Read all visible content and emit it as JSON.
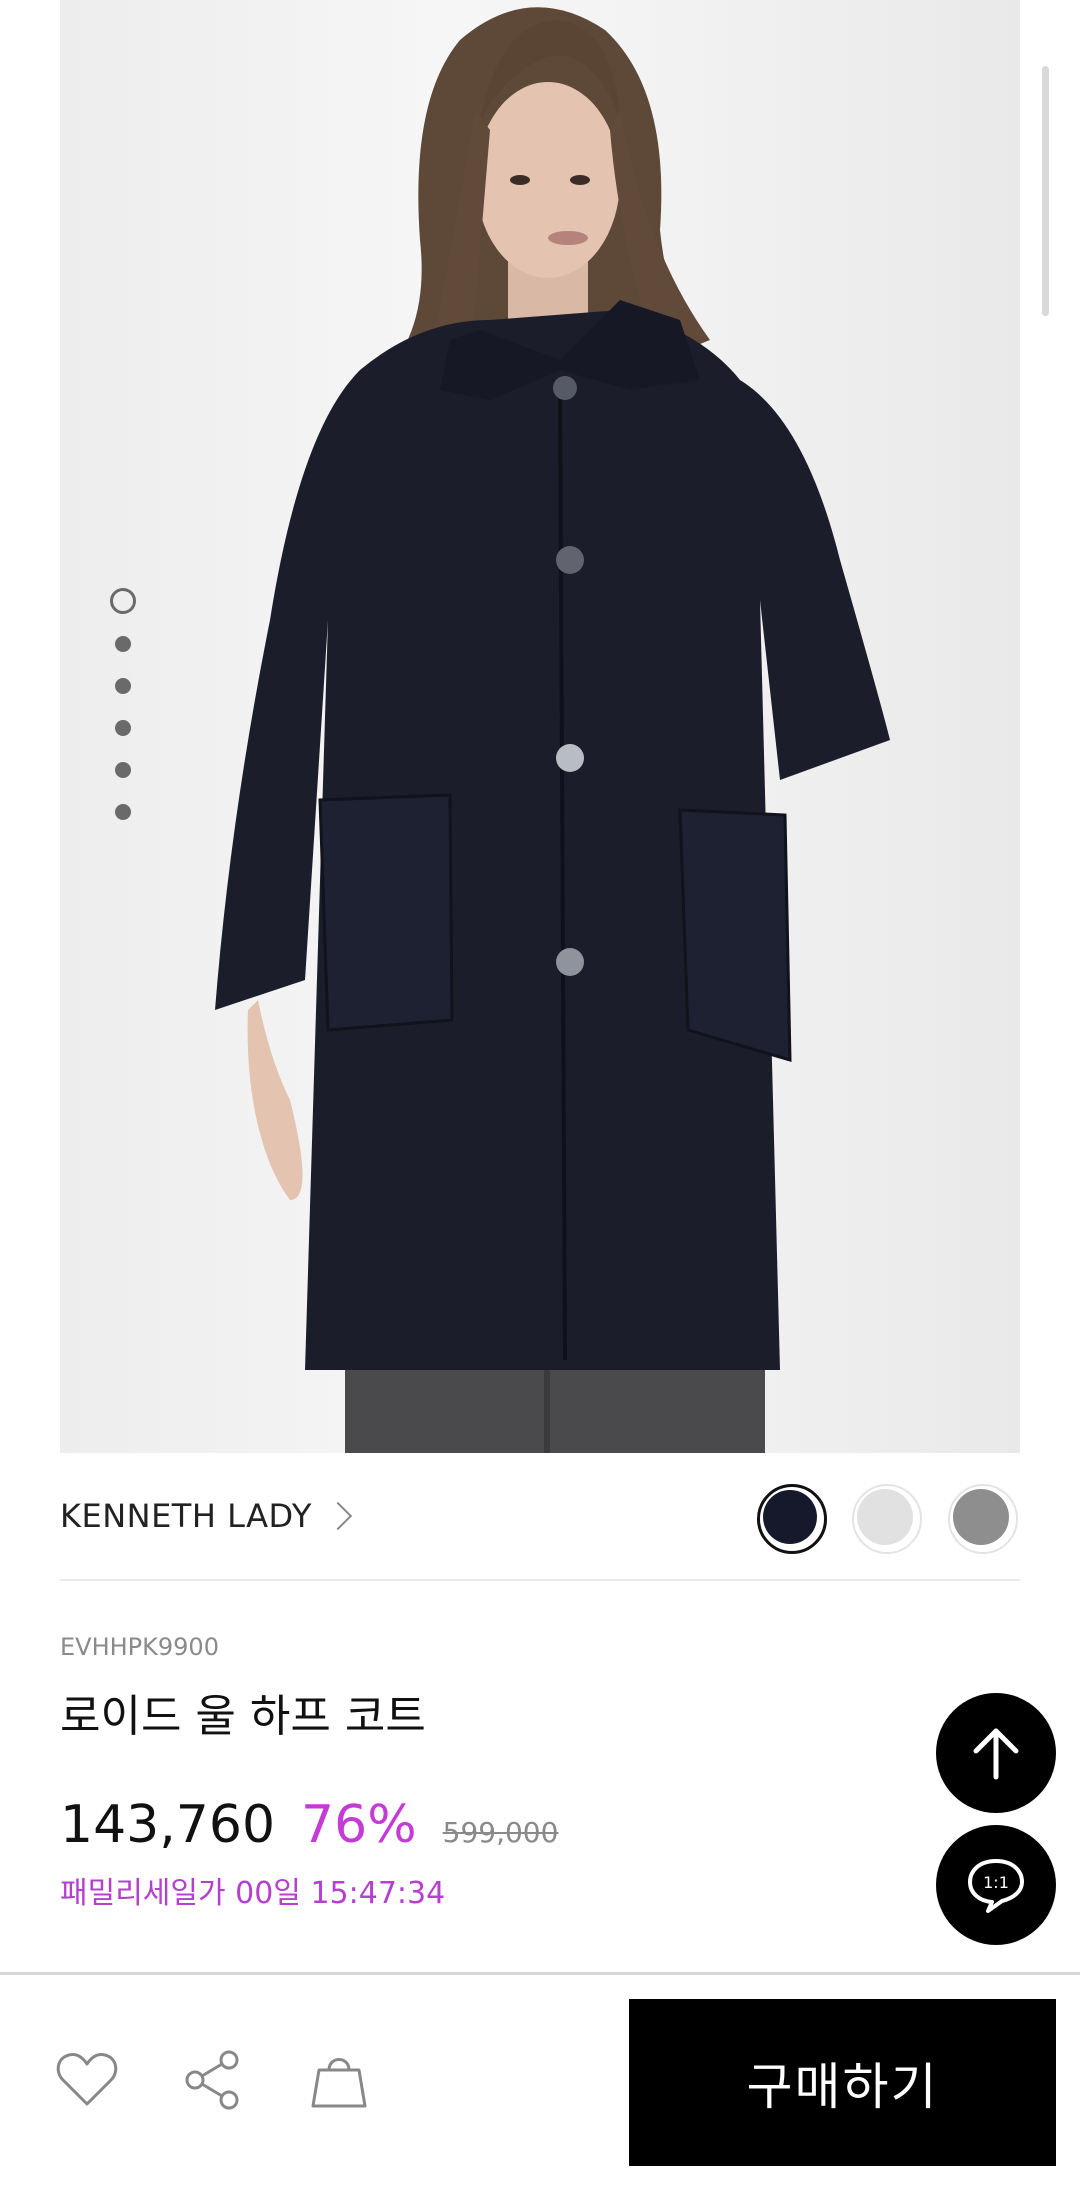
{
  "product": {
    "image_alt": "",
    "gallery_dots": 6,
    "active_dot": 0,
    "brand": "KENNETH LADY",
    "code": "EVHHPK9900",
    "name": "로이드 울 하프 코트",
    "price": "143,760",
    "discount": "76%",
    "original_price": "599,000",
    "family_sale": "패밀리세일가 00일 15:47:34",
    "swatches": [
      {
        "color": "#16192c",
        "selected": true
      },
      {
        "color": "#e1e1e1",
        "selected": false
      },
      {
        "color": "#8e8e8e",
        "selected": false
      }
    ]
  },
  "fabs": {
    "scroll_top_icon": "arrow-up-icon",
    "chat_label": "1:1"
  },
  "bottom_bar": {
    "buy_label": "구매하기",
    "icons": [
      "heart-icon",
      "share-icon",
      "shopping-bag-icon"
    ]
  },
  "colors": {
    "accent": "#c43bd6",
    "family_sale": "#b53fce",
    "button": "#000000"
  }
}
